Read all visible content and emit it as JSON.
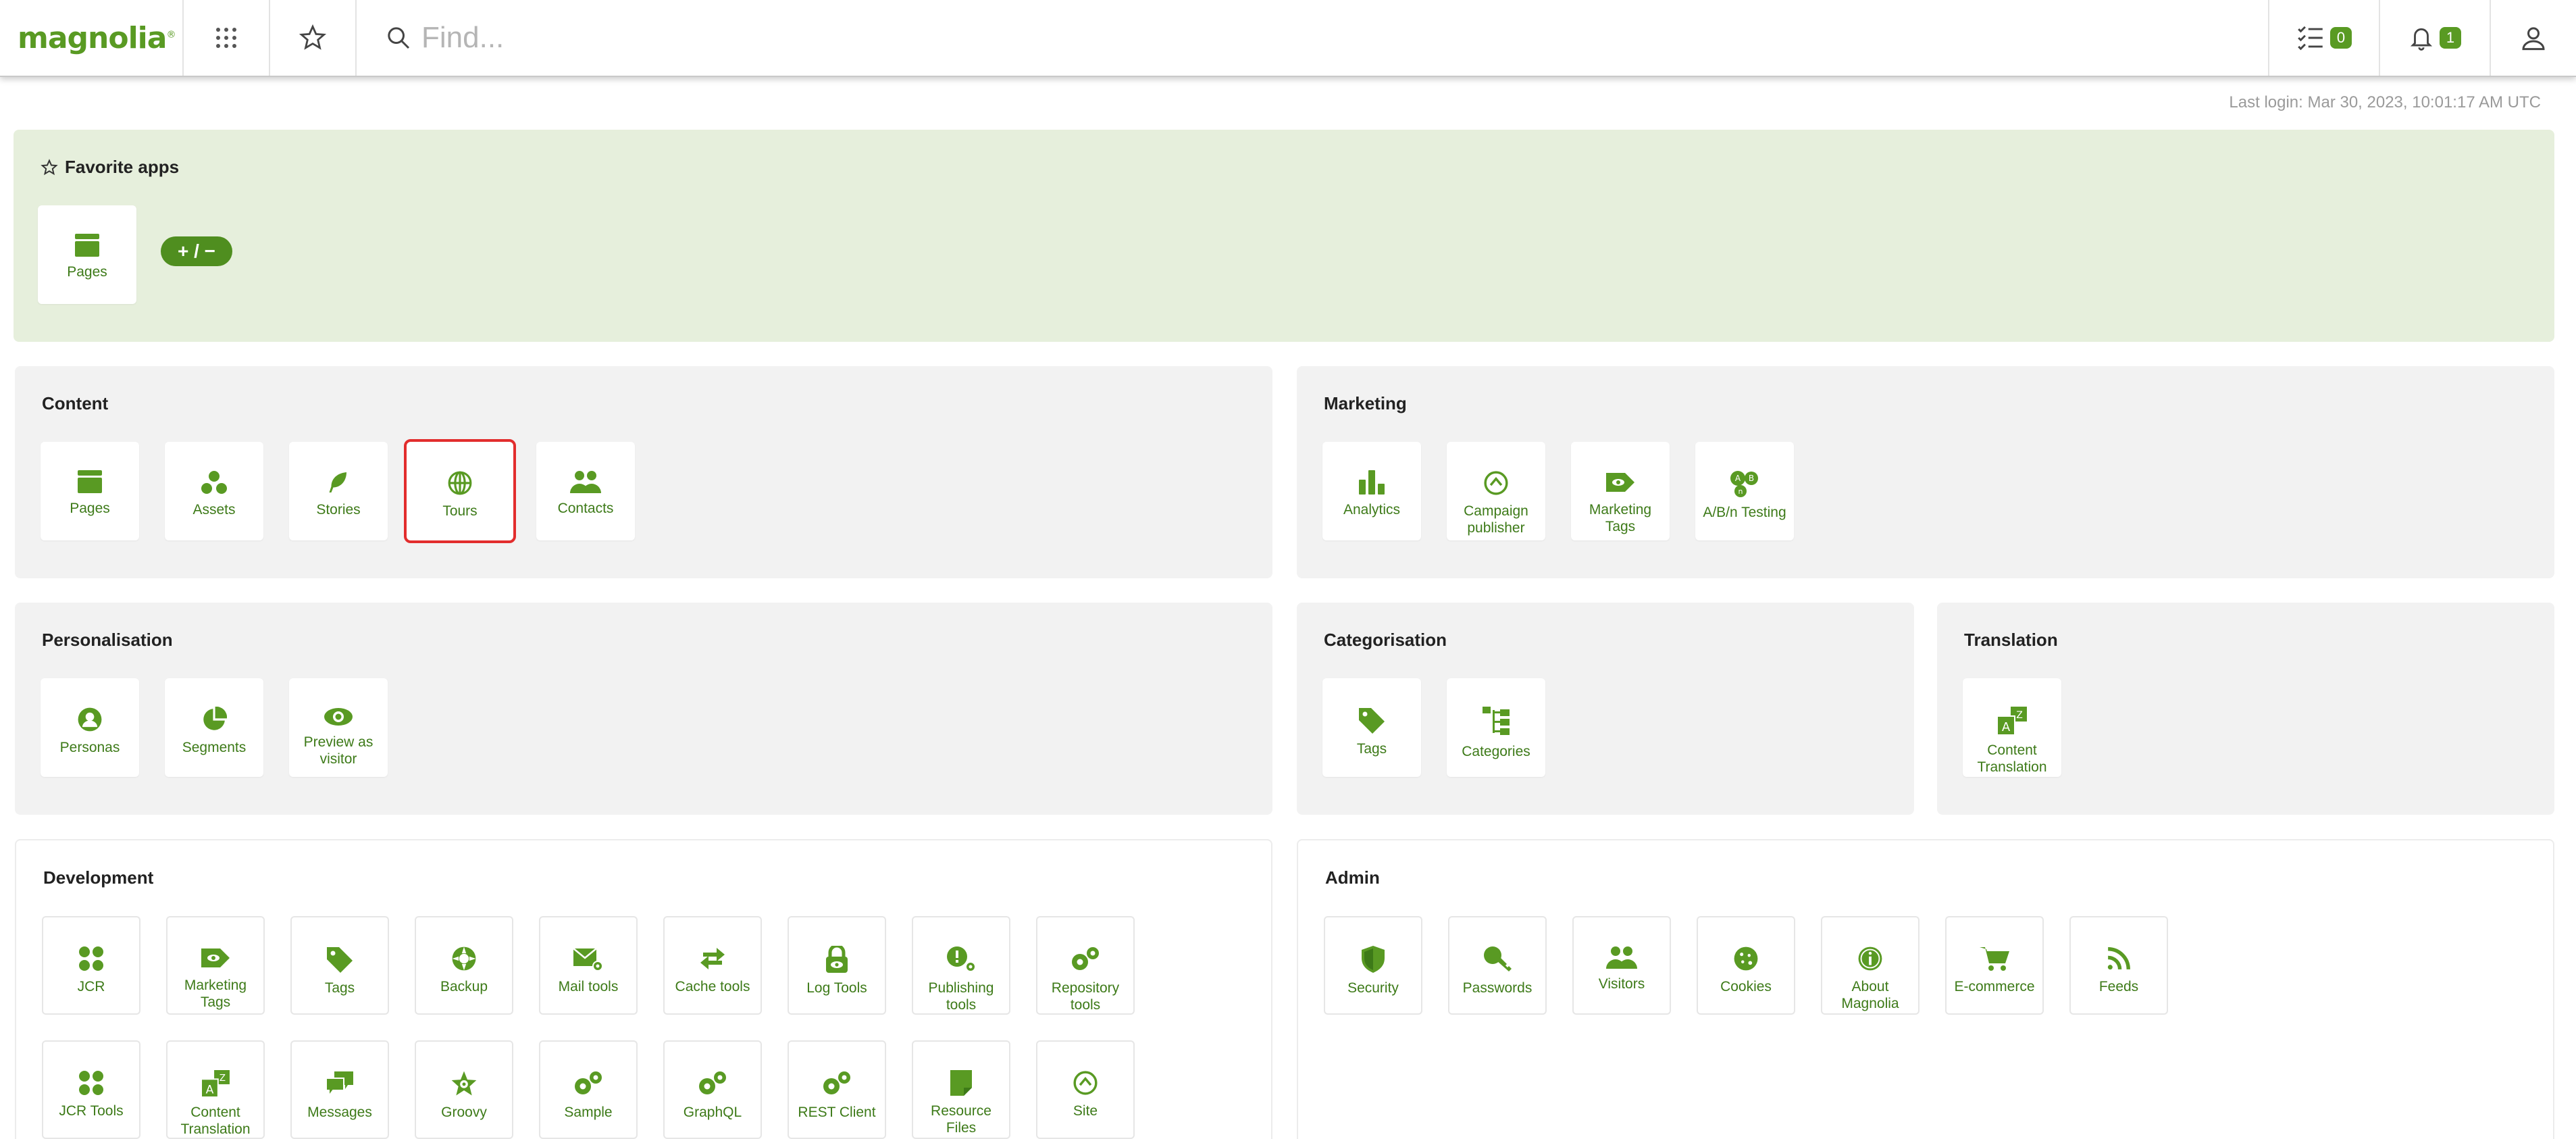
{
  "topbar": {
    "logo": "magnolia",
    "logo_mark": "®",
    "search_placeholder": "Find...",
    "tasks_count": "0",
    "notifications_count": "1"
  },
  "last_login": "Last login: Mar 30, 2023, 10:01:17 AM UTC",
  "favorites": {
    "title": "Favorite apps",
    "apps": [
      "Pages"
    ],
    "edit_label": "+ / −"
  },
  "groups": {
    "content": {
      "title": "Content",
      "apps": [
        "Pages",
        "Assets",
        "Stories",
        "Tours",
        "Contacts"
      ]
    },
    "marketing": {
      "title": "Marketing",
      "apps": [
        "Analytics",
        "Campaign publisher",
        "Marketing Tags",
        "A/B/n Testing"
      ]
    },
    "personalisation": {
      "title": "Personalisation",
      "apps": [
        "Personas",
        "Segments",
        "Preview as visitor"
      ]
    },
    "categorisation": {
      "title": "Categorisation",
      "apps": [
        "Tags",
        "Categories"
      ]
    },
    "translation": {
      "title": "Translation",
      "apps": [
        "Content Translation"
      ]
    },
    "development": {
      "title": "Development",
      "apps": [
        "JCR",
        "Marketing Tags",
        "Tags",
        "Backup",
        "Mail tools",
        "Cache tools",
        "Log Tools",
        "Publishing tools",
        "Repository tools",
        "JCR Tools",
        "Content Translation",
        "Messages",
        "Groovy",
        "Sample",
        "GraphQL",
        "REST Client",
        "Resource Files",
        "Site"
      ]
    },
    "admin": {
      "title": "Admin",
      "apps": [
        "Security",
        "Passwords",
        "Visitors",
        "Cookies",
        "About Magnolia",
        "E-commerce",
        "Feeds"
      ]
    }
  },
  "colors": {
    "accent": "#599a23",
    "selection": "#e22d2d",
    "favorites_bg": "#e6efdc",
    "group_bg": "#f2f2f2"
  }
}
